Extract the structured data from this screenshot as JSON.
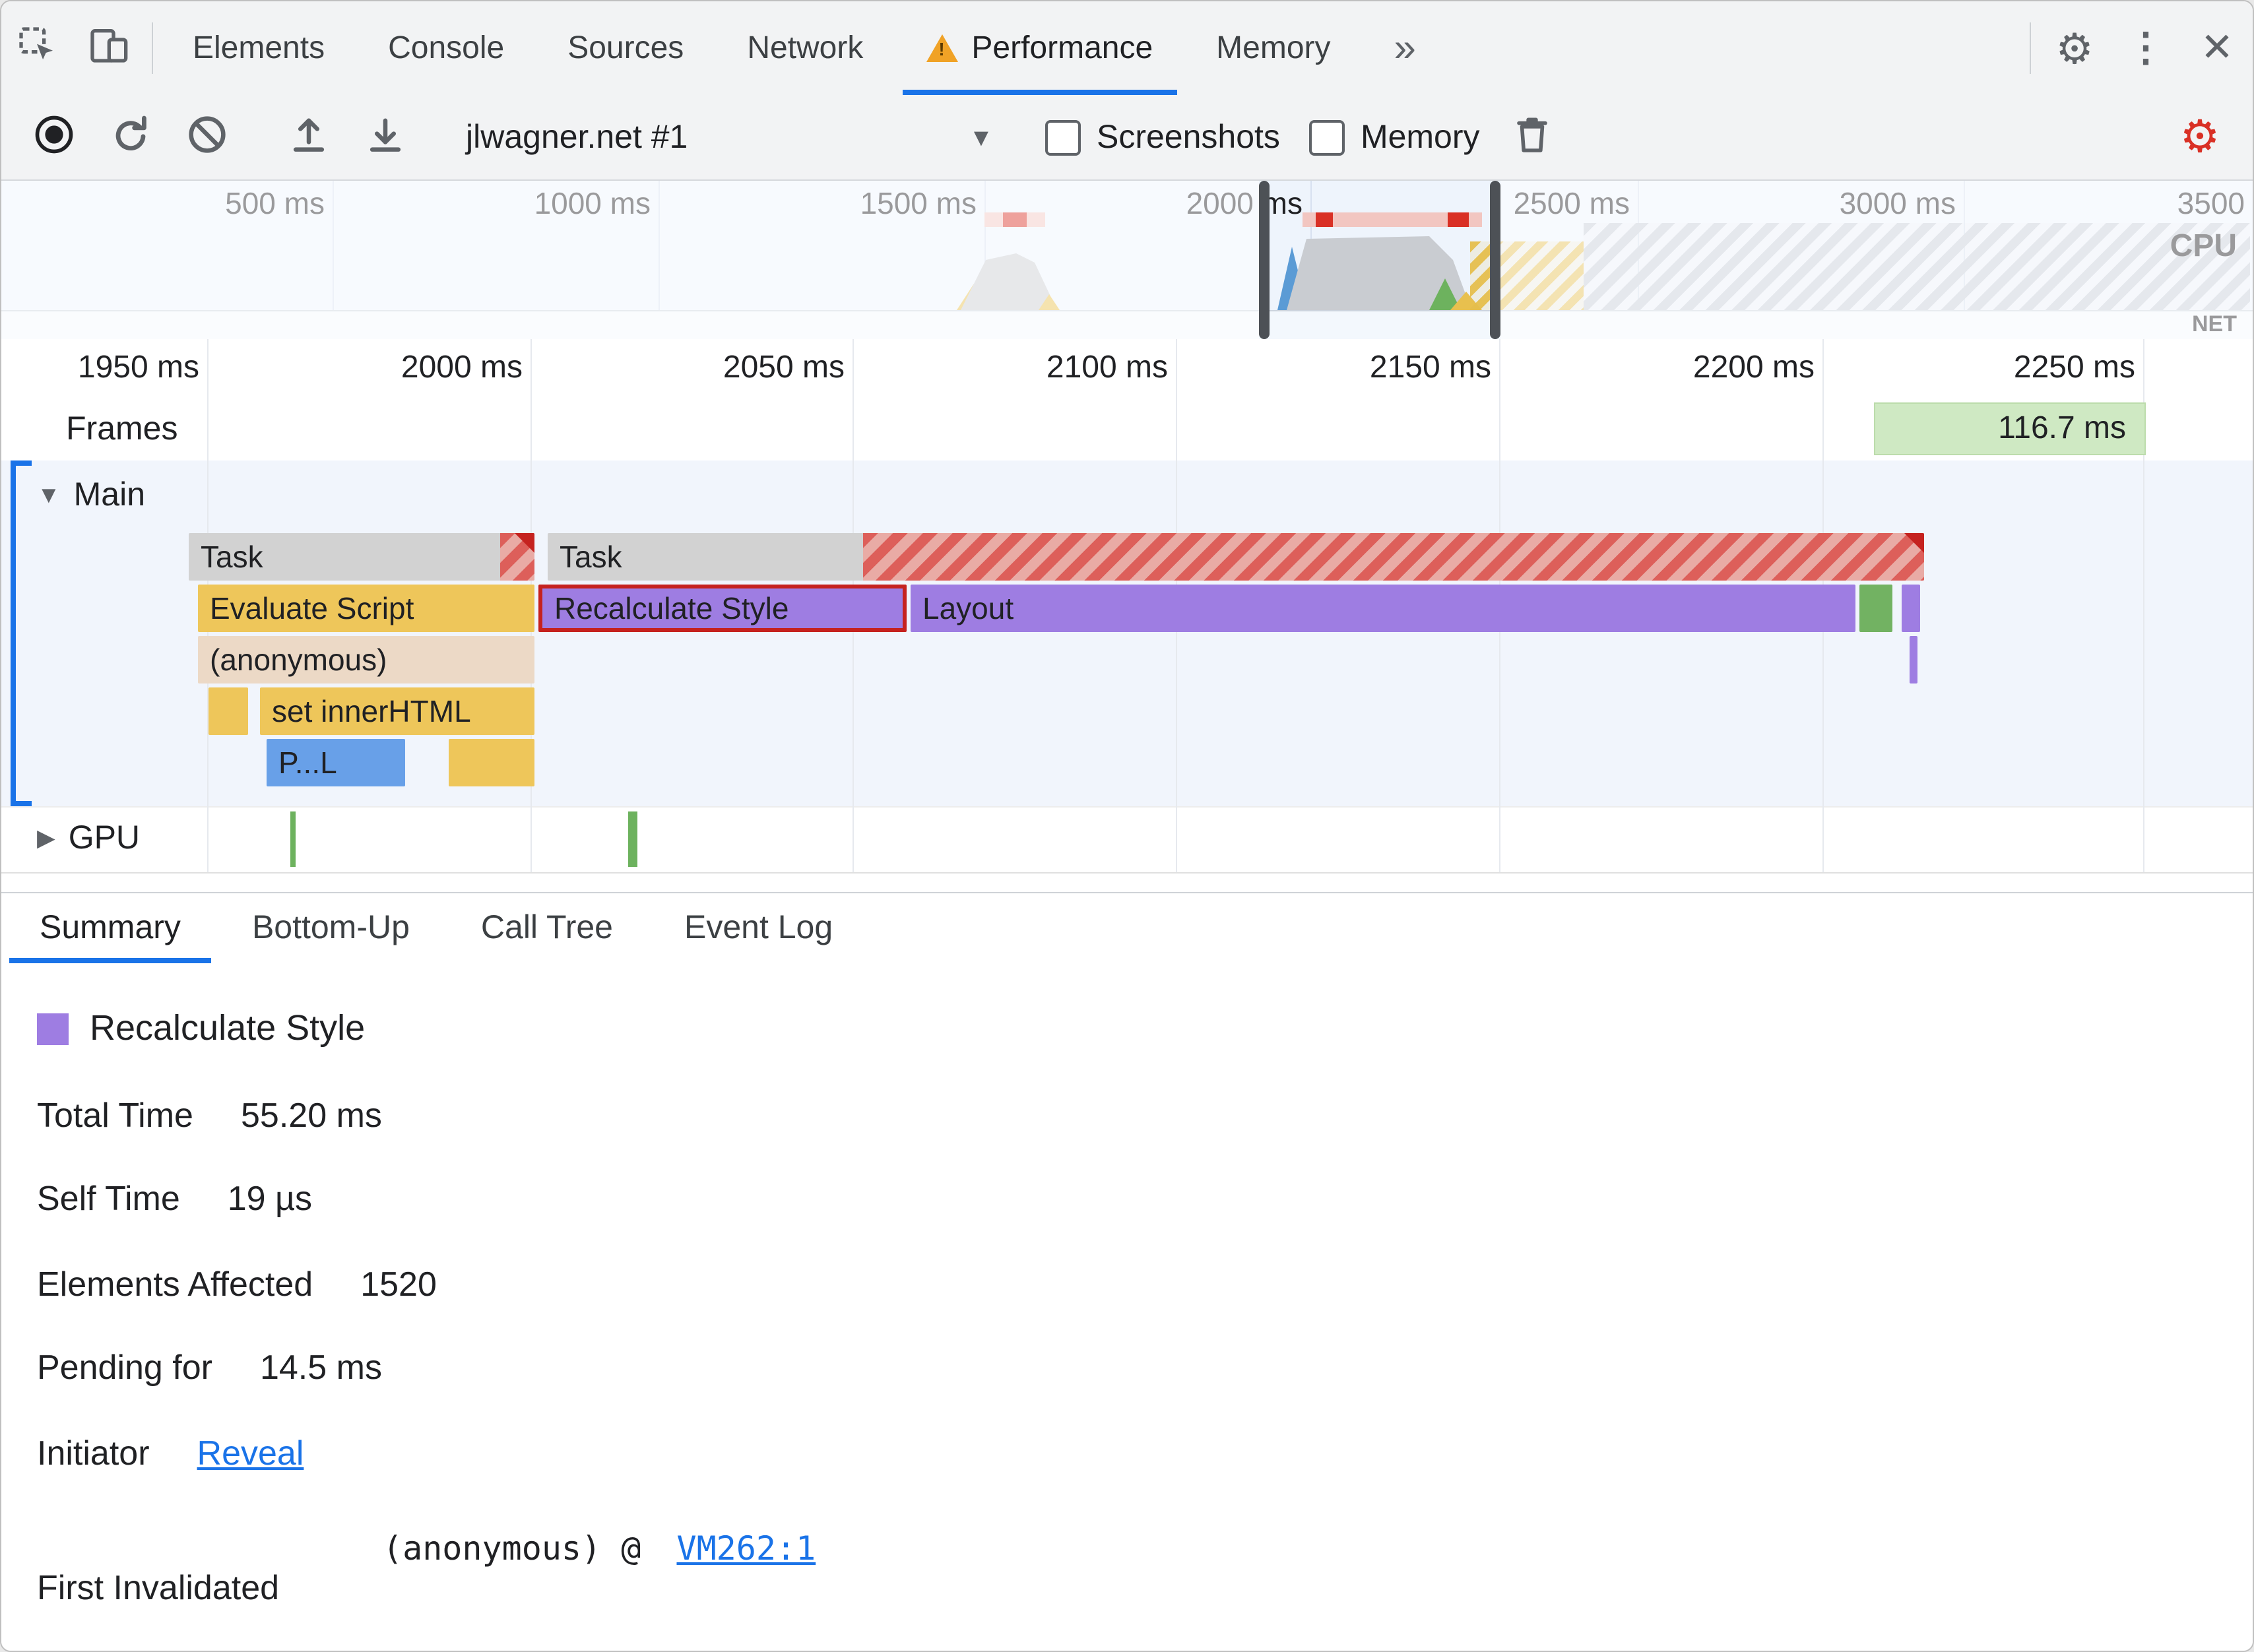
{
  "devtools_tabs": {
    "elements": "Elements",
    "console": "Console",
    "sources": "Sources",
    "network": "Network",
    "performance": "Performance",
    "memory": "Memory",
    "more": "»"
  },
  "toolbar": {
    "profile": "jlwagner.net #1",
    "screenshots": "Screenshots",
    "memory": "Memory"
  },
  "overview": {
    "ticks": [
      "500 ms",
      "1000 ms",
      "1500 ms",
      "2000 ms",
      "2500 ms",
      "3000 ms",
      "3500"
    ],
    "cpu": "CPU",
    "net": "NET"
  },
  "timeline": {
    "ticks": [
      "1950 ms",
      "2000 ms",
      "2050 ms",
      "2100 ms",
      "2150 ms",
      "2200 ms",
      "2250 ms"
    ],
    "frames": "Frames",
    "frame_time": "116.7 ms",
    "main": "Main",
    "gpu": "GPU",
    "bars": {
      "task1": "Task",
      "task2": "Task",
      "evaluate_script": "Evaluate Script",
      "recalculate_style": "Recalculate Style",
      "layout": "Layout",
      "anonymous": "(anonymous)",
      "set_innerhtml": "set innerHTML",
      "parse": "P...L"
    }
  },
  "bottom_tabs": {
    "summary": "Summary",
    "bottom_up": "Bottom-Up",
    "call_tree": "Call Tree",
    "event_log": "Event Log"
  },
  "summary": {
    "title": "Recalculate Style",
    "total_time_label": "Total Time",
    "total_time": "55.20 ms",
    "self_time_label": "Self Time",
    "self_time": "19 µs",
    "elements_affected_label": "Elements Affected",
    "elements_affected": "1520",
    "pending_label": "Pending for",
    "pending": "14.5 ms",
    "initiator_label": "Initiator",
    "initiator_link": "Reveal",
    "first_invalidated_label": "First Invalidated",
    "first_invalidated_prefix": "(anonymous) @",
    "first_invalidated_link": "VM262:1"
  },
  "colors": {
    "accent_blue": "#1a73e8",
    "scripting_yellow": "#eec65a",
    "rendering_purple": "#9e7de2",
    "painting_green": "#72b262",
    "task_gray": "#d2d2d2",
    "long_task_red": "#dd5f5a",
    "selection_red": "#c5221f",
    "warning_orange": "#f0a226",
    "link_blue": "#1a73e8"
  }
}
